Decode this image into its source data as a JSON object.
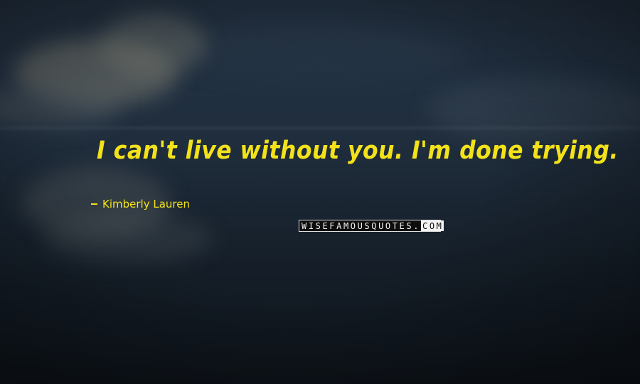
{
  "quote": {
    "text": "I can't live without you. I'm done trying.",
    "text_color": "#f3e21a"
  },
  "author": {
    "name": "Kimberly Lauren",
    "prefix_icon": "dash-icon"
  },
  "watermark": {
    "main": "WISEFAMOUSQUOTES.",
    "tld": "COM"
  },
  "background": {
    "sky_color": "#213041",
    "dark_color": "#0e141b"
  }
}
